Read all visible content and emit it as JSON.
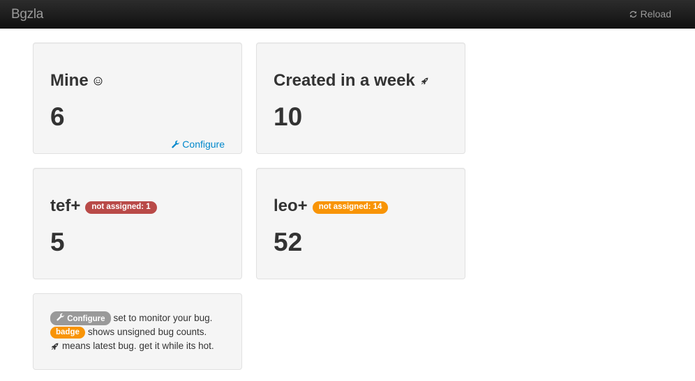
{
  "navbar": {
    "brand": "Bgzla",
    "reload_label": "Reload"
  },
  "cards": [
    {
      "title": "Mine",
      "count": "6",
      "configure_label": "Configure"
    },
    {
      "title": "Created in a week",
      "count": "10"
    },
    {
      "title": "tef+",
      "badge": "not assigned: 1",
      "count": "5"
    },
    {
      "title": "leo+",
      "badge": "not assigned: 14",
      "count": "52"
    }
  ],
  "help": {
    "configure_badge": "Configure",
    "line1": "set to monitor your bug.",
    "badge_label": "badge",
    "line2": "shows unsigned bug counts.",
    "line3": "means latest bug. get it while its hot."
  },
  "colors": {
    "navbar": "#111111",
    "link": "#0088cc",
    "badge_red": "#b94a48",
    "badge_orange": "#f89406",
    "badge_gray": "#999999",
    "card_bg": "#f5f5f5"
  }
}
